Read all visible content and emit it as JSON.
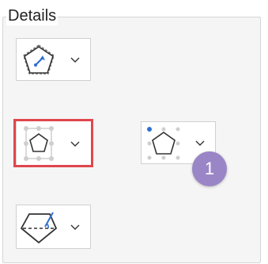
{
  "panel": {
    "title": "Details"
  },
  "buttons": [
    {
      "name": "center-anchor-shape-button",
      "icon": "pentagon-center-arrow-icon"
    },
    {
      "name": "selection-handles-shape-button",
      "icon": "pentagon-handles-icon"
    },
    {
      "name": "corner-anchor-shape-button",
      "icon": "pentagon-corner-dot-icon"
    },
    {
      "name": "section-plane-shape-button",
      "icon": "pentagon-section-icon"
    }
  ],
  "callout": {
    "badge_number": "1"
  },
  "colors": {
    "highlight": "#e0474c",
    "badge": "#9a85c7",
    "accent_blue": "#2f6fd1"
  }
}
